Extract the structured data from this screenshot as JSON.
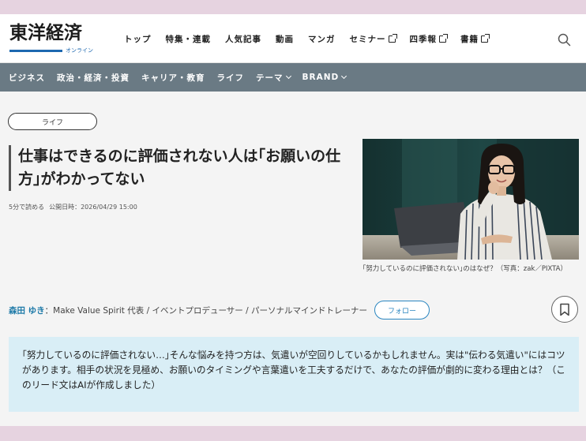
{
  "header": {
    "logo_main": "東洋経済",
    "logo_sub": "オンライン",
    "nav": [
      {
        "label": "トップ",
        "external": false
      },
      {
        "label": "特集・連載",
        "external": false
      },
      {
        "label": "人気記事",
        "external": false
      },
      {
        "label": "動画",
        "external": false
      },
      {
        "label": "マンガ",
        "external": false
      },
      {
        "label": "セミナー",
        "external": true
      },
      {
        "label": "四季報",
        "external": true
      },
      {
        "label": "書籍",
        "external": true
      }
    ],
    "search_icon": "search-icon"
  },
  "subnav": [
    {
      "label": "ビジネス",
      "dropdown": false
    },
    {
      "label": "政治・経済・投資",
      "dropdown": false
    },
    {
      "label": "キャリア・教育",
      "dropdown": false
    },
    {
      "label": "ライフ",
      "dropdown": false
    },
    {
      "label": "テーマ",
      "dropdown": true
    },
    {
      "label": "BRAND",
      "dropdown": true
    }
  ],
  "article": {
    "category": "ライフ",
    "title": "仕事はできるのに評価されない人は｢お願いの仕方｣がわかってない",
    "read_time": "5分で読める",
    "published_label": "公開日時：",
    "published": "2026/04/29 15:00",
    "image_caption": "｢努力しているのに評価されない｣のはなぜ？（写真：zak／PIXTA）",
    "author_name": "森田 ゆき",
    "author_desc": "：Make Value Spirit 代表 / イベントプロデューサー / パーソナルマインドトレーナー",
    "follow_label": "フォロー",
    "bookmark_icon": "bookmark-icon",
    "lead": "｢努力しているのに評価されない…｣そんな悩みを持つ方は、気遣いが空回りしているかもしれません。実は\"伝わる気遣い\"にはコツがあります。相手の状況を見極め、お願いのタイミングや言葉遣いを工夫するだけで、あなたの評価が劇的に変わる理由とは？（このリード文はAIが作成しました）"
  },
  "colors": {
    "background_frame": "#e6d3e0",
    "subnav_bg": "#6a7a84",
    "accent_blue": "#1e7aa8",
    "lead_bg": "#d9eef6"
  }
}
